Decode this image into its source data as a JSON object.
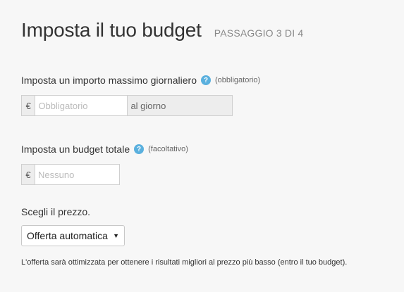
{
  "header": {
    "title": "Imposta il tuo budget",
    "step": "PASSAGGIO 3 DI 4"
  },
  "daily": {
    "label": "Imposta un importo massimo giornaliero",
    "help": "?",
    "hint": "(obbligatorio)",
    "currency": "€",
    "placeholder": "Obbligatorio",
    "suffix": "al giorno"
  },
  "total": {
    "label": "Imposta un budget totale",
    "help": "?",
    "hint": "(facoltativo)",
    "currency": "€",
    "placeholder": "Nessuno"
  },
  "price": {
    "label": "Scegli il prezzo.",
    "selected": "Offerta automatica",
    "caret": "▼",
    "note": "L'offerta sarà ottimizzata per ottenere i risultati migliori al prezzo più basso (entro il tuo budget)."
  },
  "colors": {
    "background": "#f7f7f7",
    "help_icon": "#5ab0de"
  }
}
